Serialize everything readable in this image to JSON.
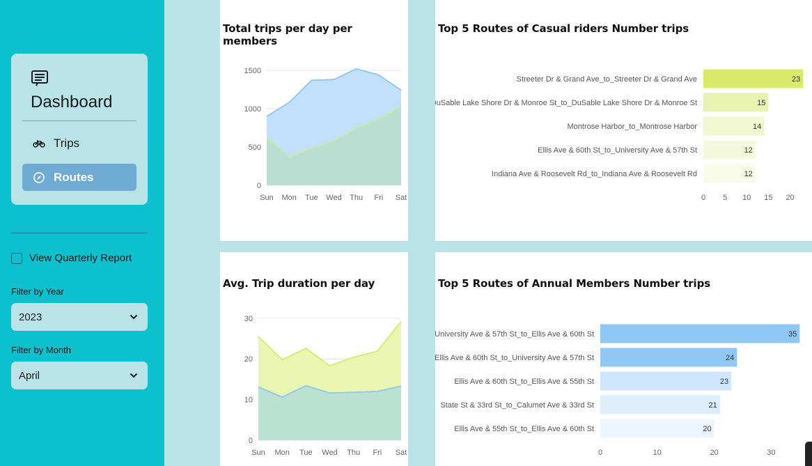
{
  "sidebar": {
    "title": "Dashboard",
    "icon": "dashboard-list-icon",
    "nav": [
      {
        "label": "Trips",
        "icon": "bicycle-icon",
        "active": false
      },
      {
        "label": "Routes",
        "icon": "compass-icon",
        "active": true
      }
    ],
    "quarterly_label": "View Quarterly Report",
    "quarterly_checked": false,
    "year_label": "Filter by Year",
    "year_value": "2023",
    "month_label": "Filter by Month",
    "month_value": "April"
  },
  "colors": {
    "sidebar_bg": "#0cc0ce",
    "page_bg": "#b9e3e6",
    "active_nav": "#6eaad2",
    "blue_area": "#c6e2fa",
    "green_area": "#e9f5b0",
    "teal_overlap": "#b9dfd5"
  },
  "chart_data": [
    {
      "type": "area",
      "title": "Total trips per day per members",
      "categories": [
        "Sun",
        "Mon",
        "Tue",
        "Wed",
        "Thu",
        "Fri",
        "Sat"
      ],
      "series": [
        {
          "values": [
            900,
            1080,
            1370,
            1380,
            1520,
            1440,
            1240
          ]
        },
        {
          "values": [
            620,
            370,
            480,
            580,
            750,
            860,
            1040
          ]
        }
      ],
      "yticks": [
        0,
        500,
        1000,
        1500
      ],
      "ylim": [
        0,
        1600
      ],
      "grid": true
    },
    {
      "type": "bar",
      "orientation": "horizontal",
      "title": "Top 5 Routes of Casual riders Number trips",
      "categories": [
        "Streeter Dr & Grand Ave_to_Streeter Dr & Grand Ave",
        "DuSable Lake Shore Dr & Monroe St_to_DuSable Lake Shore Dr & Monroe St",
        "Montrose Harbor_to_Montrose Harbor",
        "Ellis Ave & 60th St_to_University Ave & 57th St",
        "Indiana Ave & Roosevelt Rd_to_Indiana Ave & Roosevelt Rd"
      ],
      "values": [
        23,
        15,
        14,
        12,
        12
      ],
      "xticks": [
        0,
        5,
        10,
        15,
        20
      ],
      "xlim": [
        0,
        23.6
      ],
      "colors": [
        "#d9ea6a",
        "#e9f3b1",
        "#f1f8cf",
        "#f4f9dc",
        "#f8fbe8"
      ]
    },
    {
      "type": "area",
      "title": "Avg. Trip duration per day",
      "categories": [
        "Sun",
        "Mon",
        "Tue",
        "Wed",
        "Thu",
        "Fri",
        "Sat"
      ],
      "series": [
        {
          "values": [
            25.5,
            19.8,
            22.6,
            18.3,
            20.4,
            21.9,
            29.2
          ]
        },
        {
          "values": [
            13.1,
            10.6,
            13.4,
            11.6,
            11.8,
            12.0,
            13.3
          ]
        }
      ],
      "yticks": [
        0,
        10,
        20,
        30
      ],
      "ylim": [
        0,
        31
      ],
      "grid": true
    },
    {
      "type": "bar",
      "orientation": "horizontal",
      "title": "Top 5 Routes of Annual Members Number trips",
      "categories": [
        "University Ave & 57th St_to_Ellis Ave & 60th St",
        "Ellis Ave & 60th St_to_University Ave & 57th St",
        "Ellis Ave & 60th St_to_Ellis Ave & 55th St",
        "State St & 33rd St_to_Calumet Ave & 33rd St",
        "Ellis Ave & 55th St_to_Ellis Ave & 60th St"
      ],
      "values": [
        35,
        24,
        23,
        21,
        20
      ],
      "xticks": [
        0,
        10,
        20,
        30
      ],
      "xlim": [
        0,
        35.7
      ],
      "colors": [
        "#8ec6f4",
        "#90c7f5",
        "#cde6fb",
        "#dcedfc",
        "#edf5fe"
      ]
    }
  ]
}
